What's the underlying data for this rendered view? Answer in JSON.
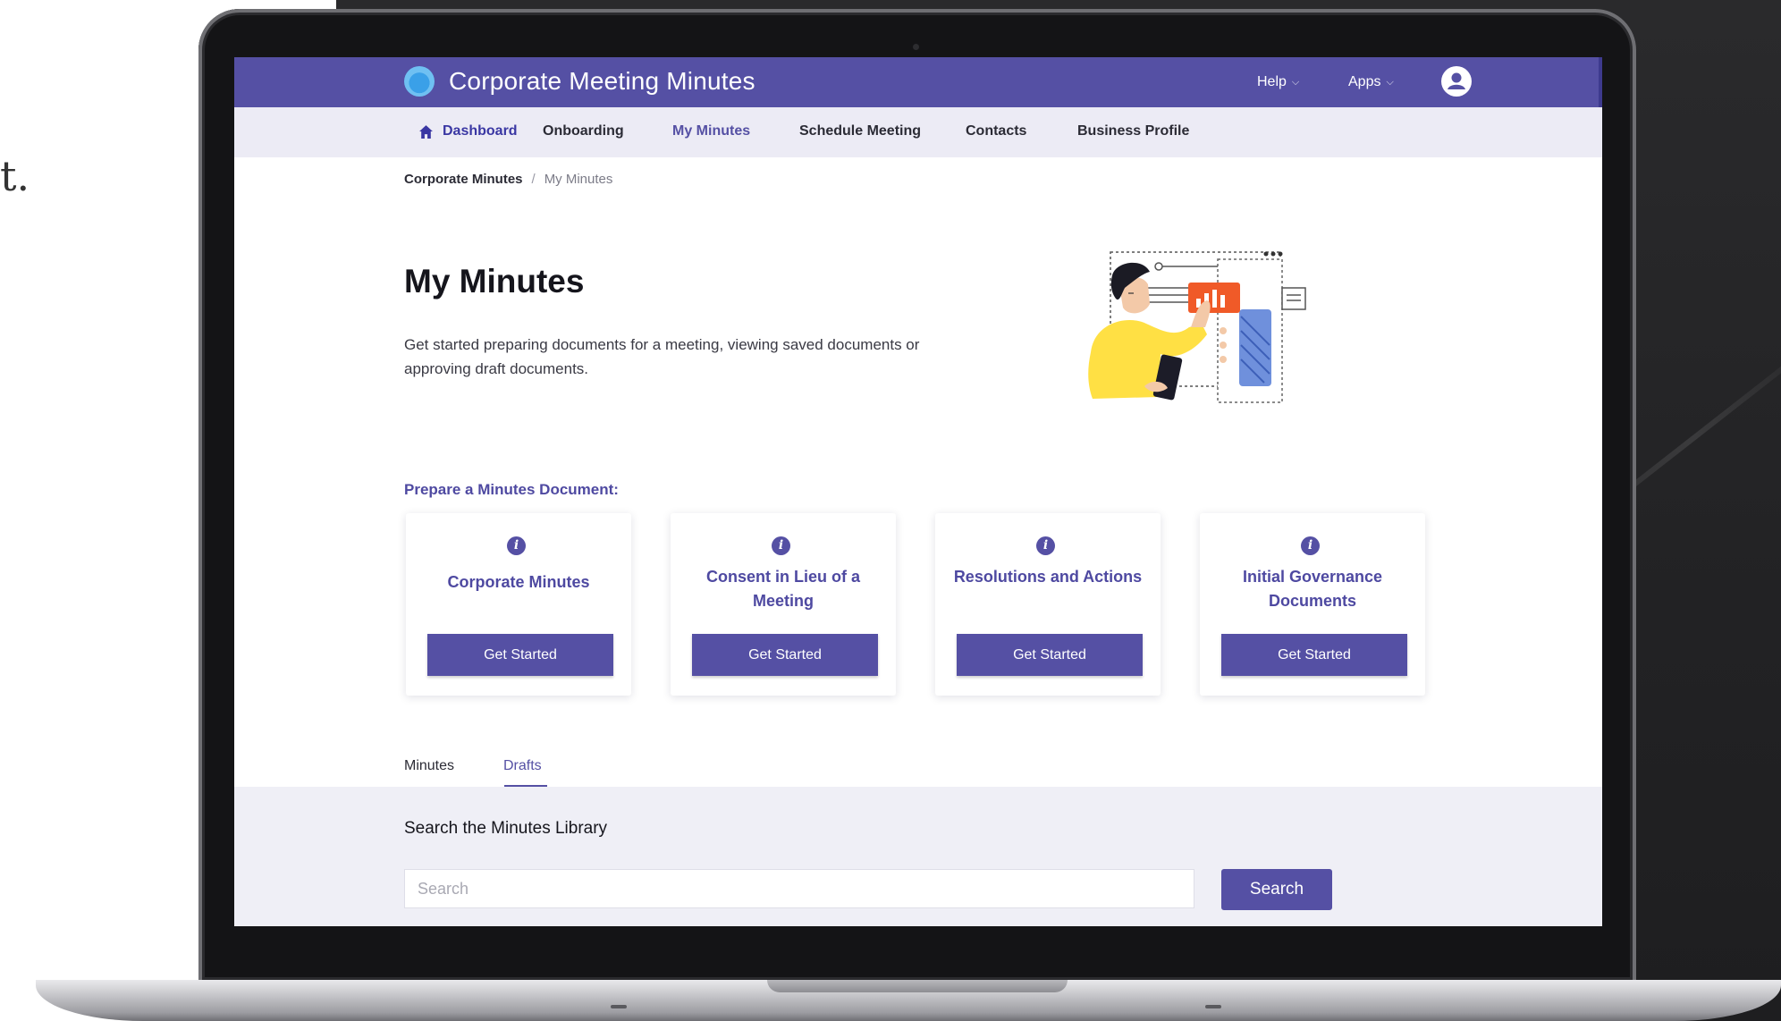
{
  "app": {
    "title": "Corporate Meeting Minutes"
  },
  "header": {
    "help_label": "Help",
    "apps_label": "Apps",
    "user_icon": "user-avatar-icon",
    "brand_color": "#5550a4"
  },
  "nav": {
    "items": [
      {
        "label": "Dashboard",
        "icon": "home-icon"
      },
      {
        "label": "Onboarding"
      },
      {
        "label": "My Minutes",
        "active": true
      },
      {
        "label": "Schedule Meeting"
      },
      {
        "label": "Contacts"
      },
      {
        "label": "Business Profile"
      }
    ]
  },
  "breadcrumb": {
    "root": "Corporate Minutes",
    "separator": "/",
    "current": "My Minutes"
  },
  "main": {
    "title": "My Minutes",
    "description": "Get started preparing documents for a meeting, viewing saved documents or approving draft documents.",
    "prepare_heading": "Prepare a Minutes Document:",
    "cards": [
      {
        "title": "Corporate Minutes",
        "button": "Get Started",
        "icon": "info-icon"
      },
      {
        "title": "Consent in Lieu of a Meeting",
        "button": "Get Started",
        "icon": "info-icon"
      },
      {
        "title": "Resolutions and Actions",
        "button": "Get Started",
        "icon": "info-icon"
      },
      {
        "title": "Initial Governance Documents",
        "button": "Get Started",
        "icon": "info-icon"
      }
    ],
    "tabs": [
      {
        "label": "Minutes"
      },
      {
        "label": "Drafts",
        "active": true
      }
    ]
  },
  "search": {
    "heading": "Search the Minutes Library",
    "placeholder": "Search",
    "button": "Search"
  },
  "backdrop": {
    "stray_glyph": "t."
  }
}
